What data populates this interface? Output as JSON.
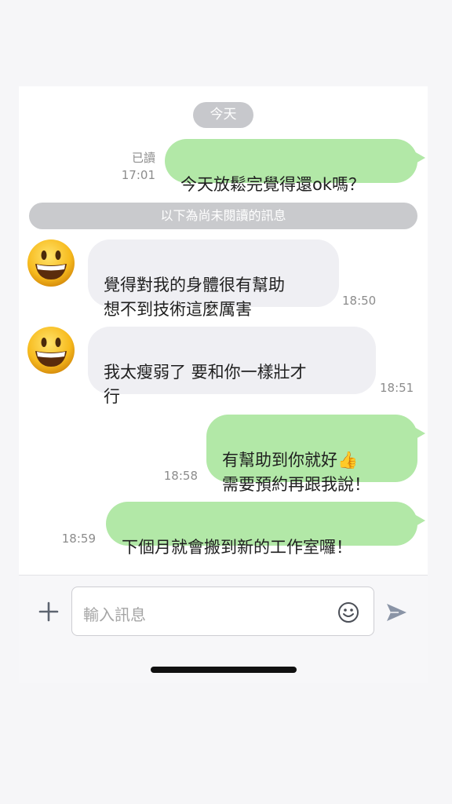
{
  "chat": {
    "date_label": "今天",
    "unread_divider": "以下為尚未閱讀的訊息",
    "messages": [
      {
        "direction": "out",
        "text": "今天放鬆完覺得還ok嗎？",
        "read_label": "已讀",
        "time": "17:01"
      },
      {
        "direction": "in",
        "text": "覺得對我的身體很有幫助\n想不到技術這麼厲害",
        "time": "18:50",
        "avatar": "grinning-face-emoji"
      },
      {
        "direction": "in",
        "text": "我太瘦弱了 要和你一樣壯才\n行",
        "time": "18:51",
        "avatar": "grinning-face-emoji"
      },
      {
        "direction": "out",
        "text": "有幫助到你就好👍\n需要預約再跟我說！",
        "time": "18:58"
      },
      {
        "direction": "out",
        "text": "下個月就會搬到新的工作室囉！",
        "time": "18:59"
      }
    ]
  },
  "input_bar": {
    "placeholder": "輸入訊息",
    "icons": [
      "plus-icon",
      "emoji-icon",
      "send-icon"
    ]
  },
  "colors": {
    "outgoing_bubble": "#b2e8a7",
    "incoming_bubble": "#efeff3",
    "pill": "#c7c8cc"
  }
}
